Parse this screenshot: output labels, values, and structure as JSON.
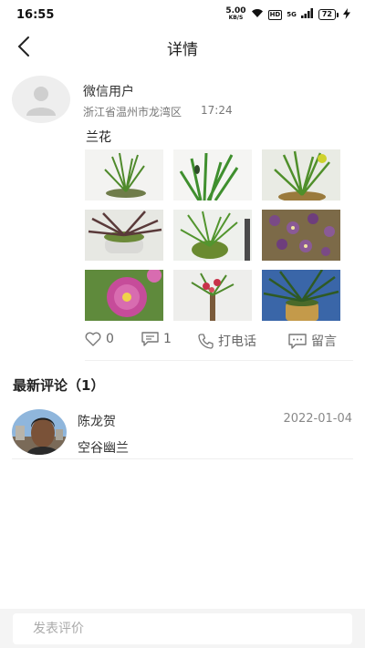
{
  "status_bar": {
    "time": "16:55",
    "net_speed": "5.00",
    "net_unit": "KB/S",
    "hd_label": "HD",
    "signal_label": "5G",
    "battery": "72"
  },
  "nav": {
    "title": "详情"
  },
  "post": {
    "author": "微信用户",
    "location": "浙江省温州市龙湾区",
    "time": "17:24",
    "text": "兰花",
    "photos": [
      {
        "icon": "orchid-plant-photo"
      },
      {
        "icon": "orchid-plant-photo"
      },
      {
        "icon": "orchid-flowering-photo"
      },
      {
        "icon": "orchid-pot-photo"
      },
      {
        "icon": "orchid-pot-photo"
      },
      {
        "icon": "orchid-purple-flowers-photo"
      },
      {
        "icon": "peony-flower-photo"
      },
      {
        "icon": "orchid-red-flowers-photo"
      },
      {
        "icon": "orchid-blue-pot-photo"
      }
    ],
    "likes": "0",
    "comments": "1",
    "call_label": "打电话",
    "message_label": "留言"
  },
  "comments_section": {
    "heading": "最新评论（1）",
    "items": [
      {
        "author": "陈龙贺",
        "date": "2022-01-04",
        "text": "空谷幽兰"
      }
    ]
  },
  "bottom": {
    "input_placeholder": "发表评价"
  },
  "colors": {
    "background": "#ffffff",
    "bottom_bar": "#f4f4f4",
    "muted_text": "#777777"
  }
}
